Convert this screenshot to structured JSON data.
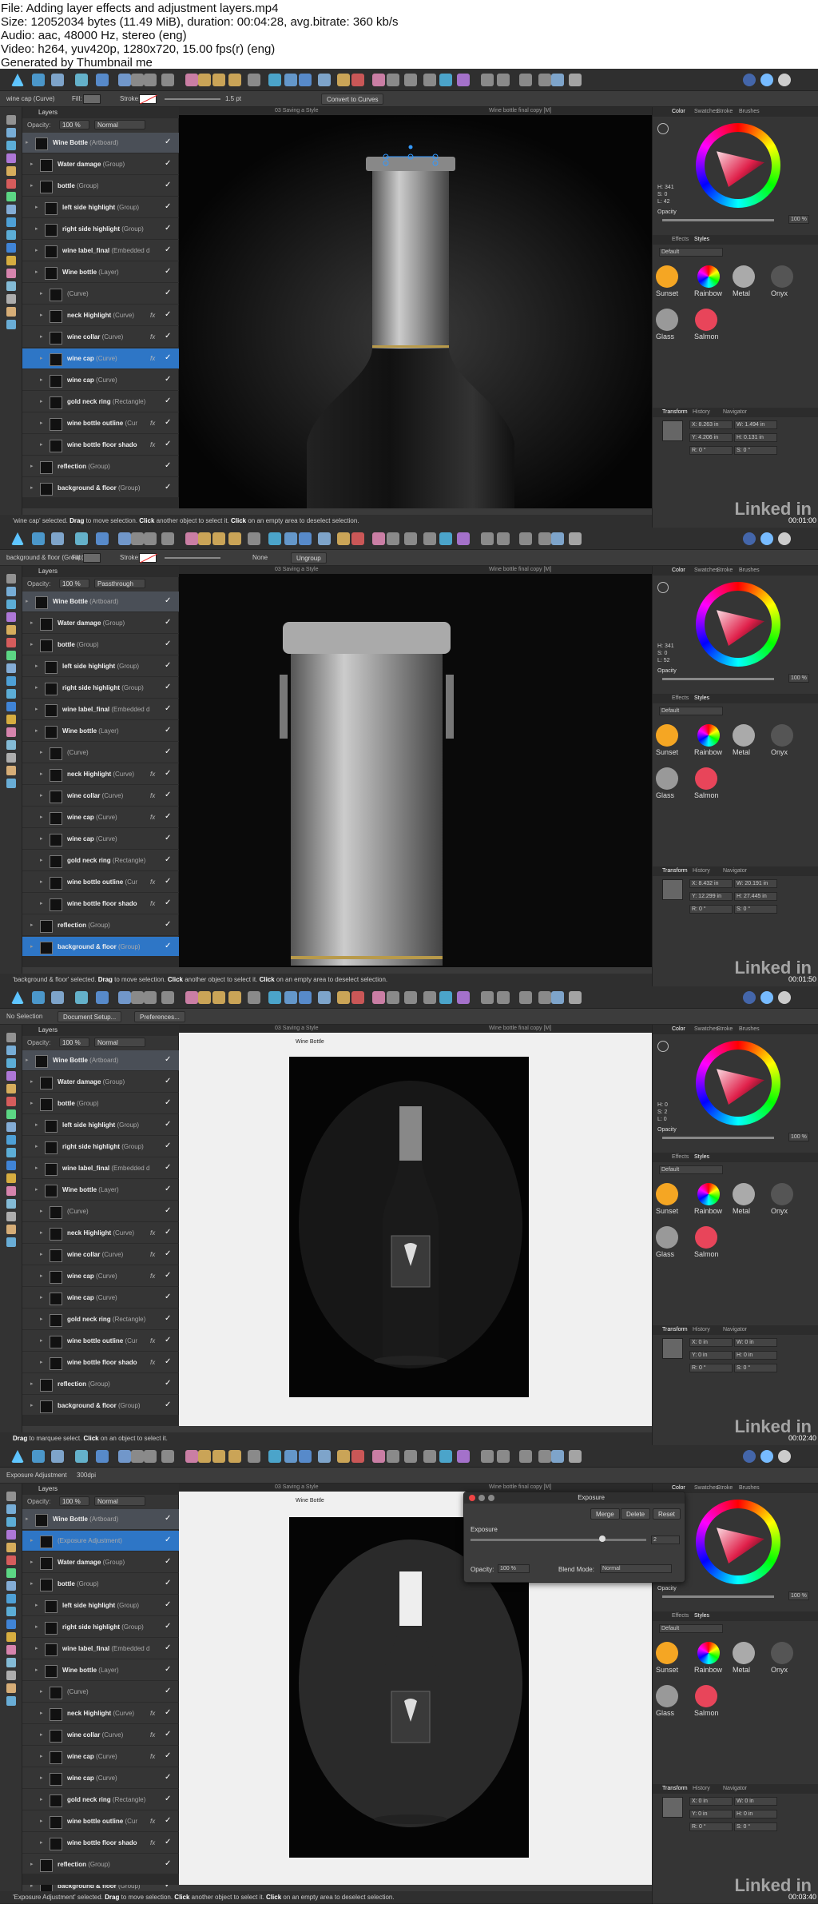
{
  "header": {
    "file": "File: Adding layer effects and adjustment layers.mp4",
    "size": "Size: 12052034 bytes (11.49 MiB), duration: 00:04:28, avg.bitrate: 360 kb/s",
    "audio": "Audio: aac, 48000 Hz, stereo (eng)",
    "video": "Video: h264, yuv420p, 1280x720, 15.00 fps(r) (eng)",
    "generated": "Generated by Thumbnail me"
  },
  "common": {
    "layers_tab": "Layers",
    "opacity_label": "Opacity:",
    "doc_left": "03 Saving a Style",
    "doc_right": "Wine bottle final copy [M]",
    "color_tabs": [
      "Color",
      "Swatches",
      "Stroke",
      "Brushes"
    ],
    "effects_tabs": [
      "Effects",
      "Styles"
    ],
    "styles_default": "Default",
    "styles": [
      "Sunset",
      "Rainbow",
      "Metal",
      "Onyx",
      "Glass",
      "Salmon"
    ],
    "transform_tabs": [
      "Transform",
      "History",
      "Navigator"
    ],
    "opacity_pct": "100 %",
    "watermark": "Linked in",
    "color_opacity": "Opacity"
  },
  "frames": [
    {
      "timestamp": "00:01:00",
      "context": {
        "name": "wine cap (Curve)",
        "fill": "Fill:",
        "stroke": "Stroke:",
        "width": "1.5 pt",
        "button": "Convert to Curves"
      },
      "opacity": "100 %",
      "blend": "Normal",
      "layers": [
        {
          "name": "Wine Bottle",
          "type": "(Artboard)",
          "indent": 0,
          "state": "art"
        },
        {
          "name": "Water damage",
          "type": "(Group)",
          "indent": 1
        },
        {
          "name": "bottle",
          "type": "(Group)",
          "indent": 1
        },
        {
          "name": "left side highlight",
          "type": "(Group)",
          "indent": 2
        },
        {
          "name": "right side highlight",
          "type": "(Group)",
          "indent": 2
        },
        {
          "name": "wine label_final",
          "type": "(Embedded d",
          "indent": 2
        },
        {
          "name": "Wine bottle",
          "type": "(Layer)",
          "indent": 2
        },
        {
          "name": "",
          "type": "(Curve)",
          "indent": 3
        },
        {
          "name": "neck Highlight",
          "type": "(Curve)",
          "indent": 3,
          "fx": "fx"
        },
        {
          "name": "wine collar",
          "type": "(Curve)",
          "indent": 3,
          "fx": "fx"
        },
        {
          "name": "wine cap",
          "type": "(Curve)",
          "indent": 3,
          "fx": "fx",
          "state": "selected"
        },
        {
          "name": "wine cap",
          "type": "(Curve)",
          "indent": 3
        },
        {
          "name": "gold neck ring",
          "type": "(Rectangle)",
          "indent": 3
        },
        {
          "name": "wine bottle outline",
          "type": "(Cur",
          "indent": 3,
          "fx": "fx"
        },
        {
          "name": "wine bottle floor shado",
          "type": "",
          "indent": 3,
          "fx": "fx"
        },
        {
          "name": "reflection",
          "type": "(Group)",
          "indent": 1
        },
        {
          "name": "background & floor",
          "type": "(Group)",
          "indent": 1
        }
      ],
      "hsl": [
        "H: 341",
        "S: 0",
        "L: 42"
      ],
      "transform": [
        "X: 8.263 in",
        "W: 1.494 in",
        "Y: 4.206 in",
        "H: 0.131 in",
        "R: 0 °",
        "S: 0 °"
      ],
      "status": {
        "pre": "'wine cap' selected.",
        "drag": "Drag",
        "mid1": " to move selection. ",
        "click": "Click",
        "mid2": " another object to select it. ",
        "click2": "Click",
        "end": " on an empty area to deselect selection."
      }
    },
    {
      "timestamp": "00:01:50",
      "context": {
        "name": "background & floor (Group)",
        "fill": "Fill:",
        "stroke": "Stroke:",
        "width": "None",
        "button": "Ungroup"
      },
      "opacity": "100 %",
      "blend": "Passthrough",
      "layers": [
        {
          "name": "Wine Bottle",
          "type": "(Artboard)",
          "indent": 0,
          "state": "art"
        },
        {
          "name": "Water damage",
          "type": "(Group)",
          "indent": 1
        },
        {
          "name": "bottle",
          "type": "(Group)",
          "indent": 1
        },
        {
          "name": "left side highlight",
          "type": "(Group)",
          "indent": 2
        },
        {
          "name": "right side highlight",
          "type": "(Group)",
          "indent": 2
        },
        {
          "name": "wine label_final",
          "type": "(Embedded d",
          "indent": 2
        },
        {
          "name": "Wine bottle",
          "type": "(Layer)",
          "indent": 2
        },
        {
          "name": "",
          "type": "(Curve)",
          "indent": 3
        },
        {
          "name": "neck Highlight",
          "type": "(Curve)",
          "indent": 3,
          "fx": "fx"
        },
        {
          "name": "wine collar",
          "type": "(Curve)",
          "indent": 3,
          "fx": "fx"
        },
        {
          "name": "wine cap",
          "type": "(Curve)",
          "indent": 3,
          "fx": "fx"
        },
        {
          "name": "wine cap",
          "type": "(Curve)",
          "indent": 3
        },
        {
          "name": "gold neck ring",
          "type": "(Rectangle)",
          "indent": 3
        },
        {
          "name": "wine bottle outline",
          "type": "(Cur",
          "indent": 3,
          "fx": "fx"
        },
        {
          "name": "wine bottle floor shado",
          "type": "",
          "indent": 3,
          "fx": "fx"
        },
        {
          "name": "reflection",
          "type": "(Group)",
          "indent": 1
        },
        {
          "name": "background & floor",
          "type": "(Group)",
          "indent": 1,
          "state": "selected"
        }
      ],
      "hsl": [
        "H: 341",
        "S: 0",
        "L: 52"
      ],
      "transform": [
        "X: 8.432 in",
        "W: 20.191 in",
        "Y: 12.299 in",
        "H: 27.445 in",
        "R: 0 °",
        "S: 0 °"
      ],
      "status": {
        "pre": "'background & floor' selected.",
        "drag": "Drag",
        "mid1": " to move selection. ",
        "click": "Click",
        "mid2": " another object to select it. ",
        "click2": "Click",
        "end": " on an empty area to deselect selection."
      }
    },
    {
      "timestamp": "00:02:40",
      "context": {
        "name": "No Selection",
        "button": "Document Setup...",
        "button2": "Preferences..."
      },
      "opacity": "100 %",
      "blend": "Normal",
      "artboard_label": "Wine Bottle",
      "layers": [
        {
          "name": "Wine Bottle",
          "type": "(Artboard)",
          "indent": 0,
          "state": "art"
        },
        {
          "name": "Water damage",
          "type": "(Group)",
          "indent": 1
        },
        {
          "name": "bottle",
          "type": "(Group)",
          "indent": 1
        },
        {
          "name": "left side highlight",
          "type": "(Group)",
          "indent": 2
        },
        {
          "name": "right side highlight",
          "type": "(Group)",
          "indent": 2
        },
        {
          "name": "wine label_final",
          "type": "(Embedded d",
          "indent": 2
        },
        {
          "name": "Wine bottle",
          "type": "(Layer)",
          "indent": 2
        },
        {
          "name": "",
          "type": "(Curve)",
          "indent": 3
        },
        {
          "name": "neck Highlight",
          "type": "(Curve)",
          "indent": 3,
          "fx": "fx"
        },
        {
          "name": "wine collar",
          "type": "(Curve)",
          "indent": 3,
          "fx": "fx"
        },
        {
          "name": "wine cap",
          "type": "(Curve)",
          "indent": 3,
          "fx": "fx"
        },
        {
          "name": "wine cap",
          "type": "(Curve)",
          "indent": 3
        },
        {
          "name": "gold neck ring",
          "type": "(Rectangle)",
          "indent": 3
        },
        {
          "name": "wine bottle outline",
          "type": "(Cur",
          "indent": 3,
          "fx": "fx"
        },
        {
          "name": "wine bottle floor shado",
          "type": "",
          "indent": 3,
          "fx": "fx"
        },
        {
          "name": "reflection",
          "type": "(Group)",
          "indent": 1
        },
        {
          "name": "background & floor",
          "type": "(Group)",
          "indent": 1
        }
      ],
      "hsl": [
        "H: 0",
        "S: 2",
        "L: 0"
      ],
      "transform": [
        "X: 0 in",
        "W: 0 in",
        "Y: 0 in",
        "H: 0 in",
        "R: 0 °",
        "S: 0 °"
      ],
      "status": {
        "pre": "",
        "drag": "Drag",
        "mid1": " to marquee select. ",
        "click": "Click",
        "mid2": " on an object to select it.",
        "click2": "",
        "end": ""
      }
    },
    {
      "timestamp": "00:03:40",
      "context": {
        "name": "Exposure Adjustment",
        "width": "300dpi"
      },
      "opacity": "100 %",
      "blend": "Normal",
      "artboard_label": "Wine Bottle",
      "layers": [
        {
          "name": "Wine Bottle",
          "type": "(Artboard)",
          "indent": 0,
          "state": "art"
        },
        {
          "name": "",
          "type": "(Exposure Adjustment)",
          "indent": 1,
          "state": "selected"
        },
        {
          "name": "Water damage",
          "type": "(Group)",
          "indent": 1
        },
        {
          "name": "bottle",
          "type": "(Group)",
          "indent": 1
        },
        {
          "name": "left side highlight",
          "type": "(Group)",
          "indent": 2
        },
        {
          "name": "right side highlight",
          "type": "(Group)",
          "indent": 2
        },
        {
          "name": "wine label_final",
          "type": "(Embedded d",
          "indent": 2
        },
        {
          "name": "Wine bottle",
          "type": "(Layer)",
          "indent": 2
        },
        {
          "name": "",
          "type": "(Curve)",
          "indent": 3
        },
        {
          "name": "neck Highlight",
          "type": "(Curve)",
          "indent": 3,
          "fx": "fx"
        },
        {
          "name": "wine collar",
          "type": "(Curve)",
          "indent": 3,
          "fx": "fx"
        },
        {
          "name": "wine cap",
          "type": "(Curve)",
          "indent": 3,
          "fx": "fx"
        },
        {
          "name": "wine cap",
          "type": "(Curve)",
          "indent": 3
        },
        {
          "name": "gold neck ring",
          "type": "(Rectangle)",
          "indent": 3
        },
        {
          "name": "wine bottle outline",
          "type": "(Cur",
          "indent": 3,
          "fx": "fx"
        },
        {
          "name": "wine bottle floor shado",
          "type": "",
          "indent": 3,
          "fx": "fx"
        },
        {
          "name": "reflection",
          "type": "(Group)",
          "indent": 1
        },
        {
          "name": "background & floor",
          "type": "(Group)",
          "indent": 1
        }
      ],
      "hsl": [],
      "transform": [
        "X: 0 in",
        "W: 0 in",
        "Y: 0 in",
        "H: 0 in",
        "R: 0 °",
        "S: 0 °"
      ],
      "dialog": {
        "title": "Exposure",
        "merge": "Merge",
        "delete": "Delete",
        "reset": "Reset",
        "exposure_label": "Exposure",
        "exposure_value": "2",
        "exposure_fraction": 0.75,
        "opacity_label": "Opacity:",
        "opacity_value": "100 %",
        "blend_label": "Blend Mode:",
        "blend_value": "Normal"
      },
      "status": {
        "pre": "'Exposure Adjustment' selected.",
        "drag": "Drag",
        "mid1": " to move selection. ",
        "click": "Click",
        "mid2": " another object to select it. ",
        "click2": "Click",
        "end": " on an empty area to deselect selection."
      }
    }
  ]
}
